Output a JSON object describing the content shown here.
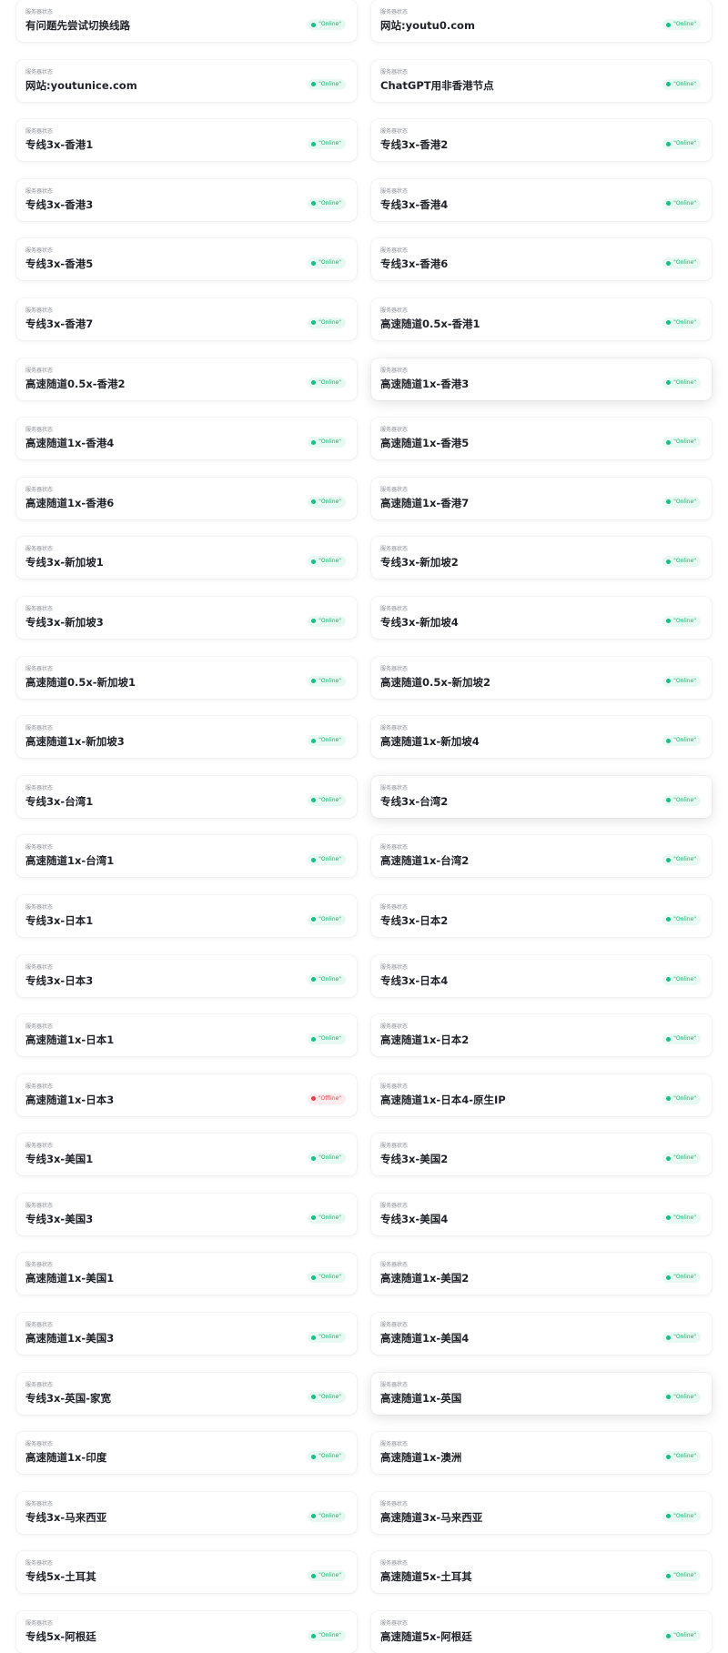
{
  "card_label": "服务器状态",
  "status_labels": {
    "online": "\"Online\"",
    "offline": "\"Offline\""
  },
  "colors": {
    "online_dot": "#12c08a",
    "online_bg": "#e8f8f2",
    "offline_dot": "#ee3b4a",
    "offline_bg": "#fdecee"
  },
  "servers": [
    {
      "name": "有问题先尝试切换线路",
      "status": "online"
    },
    {
      "name": "网站:youtu0.com",
      "status": "online"
    },
    {
      "name": "网站:youtunice.com",
      "status": "online"
    },
    {
      "name": "ChatGPT用非香港节点",
      "status": "online"
    },
    {
      "name": "专线3x-香港1",
      "status": "online"
    },
    {
      "name": "专线3x-香港2",
      "status": "online"
    },
    {
      "name": "专线3x-香港3",
      "status": "online"
    },
    {
      "name": "专线3x-香港4",
      "status": "online"
    },
    {
      "name": "专线3x-香港5",
      "status": "online"
    },
    {
      "name": "专线3x-香港6",
      "status": "online"
    },
    {
      "name": "专线3x-香港7",
      "status": "online"
    },
    {
      "name": "高速随道0.5x-香港1",
      "status": "online"
    },
    {
      "name": "高速随道0.5x-香港2",
      "status": "online"
    },
    {
      "name": "高速随道1x-香港3",
      "status": "online",
      "hover": true
    },
    {
      "name": "高速随道1x-香港4",
      "status": "online"
    },
    {
      "name": "高速随道1x-香港5",
      "status": "online"
    },
    {
      "name": "高速随道1x-香港6",
      "status": "online"
    },
    {
      "name": "高速随道1x-香港7",
      "status": "online"
    },
    {
      "name": "专线3x-新加坡1",
      "status": "online"
    },
    {
      "name": "专线3x-新加坡2",
      "status": "online"
    },
    {
      "name": "专线3x-新加坡3",
      "status": "online"
    },
    {
      "name": "专线3x-新加坡4",
      "status": "online"
    },
    {
      "name": "高速随道0.5x-新加坡1",
      "status": "online"
    },
    {
      "name": "高速随道0.5x-新加坡2",
      "status": "online"
    },
    {
      "name": "高速随道1x-新加坡3",
      "status": "online"
    },
    {
      "name": "高速随道1x-新加坡4",
      "status": "online"
    },
    {
      "name": "专线3x-台湾1",
      "status": "online"
    },
    {
      "name": "专线3x-台湾2",
      "status": "online",
      "hover": true
    },
    {
      "name": "高速随道1x-台湾1",
      "status": "online"
    },
    {
      "name": "高速随道1x-台湾2",
      "status": "online"
    },
    {
      "name": "专线3x-日本1",
      "status": "online"
    },
    {
      "name": "专线3x-日本2",
      "status": "online"
    },
    {
      "name": "专线3x-日本3",
      "status": "online"
    },
    {
      "name": "专线3x-日本4",
      "status": "online"
    },
    {
      "name": "高速随道1x-日本1",
      "status": "online"
    },
    {
      "name": "高速随道1x-日本2",
      "status": "online"
    },
    {
      "name": "高速随道1x-日本3",
      "status": "offline"
    },
    {
      "name": "高速随道1x-日本4-原生IP",
      "status": "online"
    },
    {
      "name": "专线3x-美国1",
      "status": "online"
    },
    {
      "name": "专线3x-美国2",
      "status": "online"
    },
    {
      "name": "专线3x-美国3",
      "status": "online"
    },
    {
      "name": "专线3x-美国4",
      "status": "online"
    },
    {
      "name": "高速随道1x-美国1",
      "status": "online"
    },
    {
      "name": "高速随道1x-美国2",
      "status": "online"
    },
    {
      "name": "高速随道1x-美国3",
      "status": "online"
    },
    {
      "name": "高速随道1x-美国4",
      "status": "online"
    },
    {
      "name": "专线3x-英国-家宽",
      "status": "online"
    },
    {
      "name": "高速随道1x-英国",
      "status": "online",
      "hover": true
    },
    {
      "name": "高速随道1x-印度",
      "status": "online"
    },
    {
      "name": "高速随道1x-澳洲",
      "status": "online"
    },
    {
      "name": "专线3x-马来西亚",
      "status": "online"
    },
    {
      "name": "高速随道3x-马来西亚",
      "status": "online"
    },
    {
      "name": "专线5x-土耳其",
      "status": "online"
    },
    {
      "name": "高速随道5x-土耳其",
      "status": "online"
    },
    {
      "name": "专线5x-阿根廷",
      "status": "online"
    },
    {
      "name": "高速随道5x-阿根廷",
      "status": "online"
    }
  ]
}
